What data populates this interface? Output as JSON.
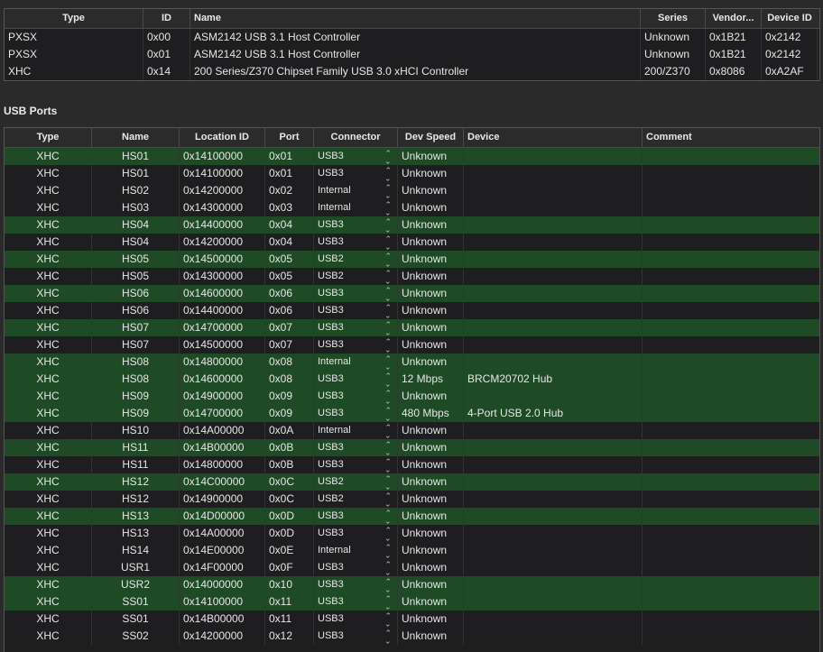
{
  "controllers": {
    "columns": [
      "Type",
      "ID",
      "Name",
      "Series",
      "Vendor...",
      "Device ID"
    ],
    "rows": [
      [
        "PXSX",
        "0x00",
        "ASM2142 USB 3.1 Host Controller",
        "Unknown",
        "0x1B21",
        "0x2142"
      ],
      [
        "PXSX",
        "0x01",
        "ASM2142 USB 3.1 Host Controller",
        "Unknown",
        "0x1B21",
        "0x2142"
      ],
      [
        "XHC",
        "0x14",
        "200 Series/Z370 Chipset Family USB 3.0 xHCI Controller",
        "200/Z370",
        "0x8086",
        "0xA2AF"
      ]
    ]
  },
  "section_title": "USB Ports",
  "ports": {
    "columns": [
      "Type",
      "Name",
      "Location ID",
      "Port",
      "Connector",
      "Dev Speed",
      "Device",
      "Comment"
    ],
    "rows": [
      {
        "type": "XHC",
        "name": "HS01",
        "location": "0x14100000",
        "port": "0x01",
        "connector": "USB3",
        "speed": "Unknown",
        "device": "",
        "comment": "",
        "active": true
      },
      {
        "type": "XHC",
        "name": "HS01",
        "location": "0x14100000",
        "port": "0x01",
        "connector": "USB3",
        "speed": "Unknown",
        "device": "",
        "comment": "",
        "active": false
      },
      {
        "type": "XHC",
        "name": "HS02",
        "location": "0x14200000",
        "port": "0x02",
        "connector": "Internal",
        "speed": "Unknown",
        "device": "",
        "comment": "",
        "active": false
      },
      {
        "type": "XHC",
        "name": "HS03",
        "location": "0x14300000",
        "port": "0x03",
        "connector": "Internal",
        "speed": "Unknown",
        "device": "",
        "comment": "",
        "active": false
      },
      {
        "type": "XHC",
        "name": "HS04",
        "location": "0x14400000",
        "port": "0x04",
        "connector": "USB3",
        "speed": "Unknown",
        "device": "",
        "comment": "",
        "active": true
      },
      {
        "type": "XHC",
        "name": "HS04",
        "location": "0x14200000",
        "port": "0x04",
        "connector": "USB3",
        "speed": "Unknown",
        "device": "",
        "comment": "",
        "active": false
      },
      {
        "type": "XHC",
        "name": "HS05",
        "location": "0x14500000",
        "port": "0x05",
        "connector": "USB2",
        "speed": "Unknown",
        "device": "",
        "comment": "",
        "active": true
      },
      {
        "type": "XHC",
        "name": "HS05",
        "location": "0x14300000",
        "port": "0x05",
        "connector": "USB2",
        "speed": "Unknown",
        "device": "",
        "comment": "",
        "active": false
      },
      {
        "type": "XHC",
        "name": "HS06",
        "location": "0x14600000",
        "port": "0x06",
        "connector": "USB3",
        "speed": "Unknown",
        "device": "",
        "comment": "",
        "active": true
      },
      {
        "type": "XHC",
        "name": "HS06",
        "location": "0x14400000",
        "port": "0x06",
        "connector": "USB3",
        "speed": "Unknown",
        "device": "",
        "comment": "",
        "active": false
      },
      {
        "type": "XHC",
        "name": "HS07",
        "location": "0x14700000",
        "port": "0x07",
        "connector": "USB3",
        "speed": "Unknown",
        "device": "",
        "comment": "",
        "active": true
      },
      {
        "type": "XHC",
        "name": "HS07",
        "location": "0x14500000",
        "port": "0x07",
        "connector": "USB3",
        "speed": "Unknown",
        "device": "",
        "comment": "",
        "active": false
      },
      {
        "type": "XHC",
        "name": "HS08",
        "location": "0x14800000",
        "port": "0x08",
        "connector": "Internal",
        "speed": "Unknown",
        "device": "",
        "comment": "",
        "active": true
      },
      {
        "type": "XHC",
        "name": "HS08",
        "location": "0x14600000",
        "port": "0x08",
        "connector": "USB3",
        "speed": "12 Mbps",
        "device": "BRCM20702 Hub",
        "comment": "",
        "active": true
      },
      {
        "type": "XHC",
        "name": "HS09",
        "location": "0x14900000",
        "port": "0x09",
        "connector": "USB3",
        "speed": "Unknown",
        "device": "",
        "comment": "",
        "active": true
      },
      {
        "type": "XHC",
        "name": "HS09",
        "location": "0x14700000",
        "port": "0x09",
        "connector": "USB3",
        "speed": "480 Mbps",
        "device": "4-Port USB 2.0 Hub",
        "comment": "",
        "active": true
      },
      {
        "type": "XHC",
        "name": "HS10",
        "location": "0x14A00000",
        "port": "0x0A",
        "connector": "Internal",
        "speed": "Unknown",
        "device": "",
        "comment": "",
        "active": false
      },
      {
        "type": "XHC",
        "name": "HS11",
        "location": "0x14B00000",
        "port": "0x0B",
        "connector": "USB3",
        "speed": "Unknown",
        "device": "",
        "comment": "",
        "active": true
      },
      {
        "type": "XHC",
        "name": "HS11",
        "location": "0x14800000",
        "port": "0x0B",
        "connector": "USB3",
        "speed": "Unknown",
        "device": "",
        "comment": "",
        "active": false
      },
      {
        "type": "XHC",
        "name": "HS12",
        "location": "0x14C00000",
        "port": "0x0C",
        "connector": "USB2",
        "speed": "Unknown",
        "device": "",
        "comment": "",
        "active": true
      },
      {
        "type": "XHC",
        "name": "HS12",
        "location": "0x14900000",
        "port": "0x0C",
        "connector": "USB2",
        "speed": "Unknown",
        "device": "",
        "comment": "",
        "active": false
      },
      {
        "type": "XHC",
        "name": "HS13",
        "location": "0x14D00000",
        "port": "0x0D",
        "connector": "USB3",
        "speed": "Unknown",
        "device": "",
        "comment": "",
        "active": true
      },
      {
        "type": "XHC",
        "name": "HS13",
        "location": "0x14A00000",
        "port": "0x0D",
        "connector": "USB3",
        "speed": "Unknown",
        "device": "",
        "comment": "",
        "active": false
      },
      {
        "type": "XHC",
        "name": "HS14",
        "location": "0x14E00000",
        "port": "0x0E",
        "connector": "Internal",
        "speed": "Unknown",
        "device": "",
        "comment": "",
        "active": false
      },
      {
        "type": "XHC",
        "name": "USR1",
        "location": "0x14F00000",
        "port": "0x0F",
        "connector": "USB3",
        "speed": "Unknown",
        "device": "",
        "comment": "",
        "active": false
      },
      {
        "type": "XHC",
        "name": "USR2",
        "location": "0x14000000",
        "port": "0x10",
        "connector": "USB3",
        "speed": "Unknown",
        "device": "",
        "comment": "",
        "active": true
      },
      {
        "type": "XHC",
        "name": "SS01",
        "location": "0x14100000",
        "port": "0x11",
        "connector": "USB3",
        "speed": "Unknown",
        "device": "",
        "comment": "",
        "active": true
      },
      {
        "type": "XHC",
        "name": "SS01",
        "location": "0x14B00000",
        "port": "0x11",
        "connector": "USB3",
        "speed": "Unknown",
        "device": "",
        "comment": "",
        "active": false
      },
      {
        "type": "XHC",
        "name": "SS02",
        "location": "0x14200000",
        "port": "0x12",
        "connector": "USB3",
        "speed": "Unknown",
        "device": "",
        "comment": "",
        "active": false
      }
    ]
  },
  "icons": {
    "connector_stepper": "up-down-chevron-icon"
  },
  "colors": {
    "active_row": "#1e4b25",
    "inactive_row": "#1e1e20",
    "header": "#2b2b2c"
  }
}
